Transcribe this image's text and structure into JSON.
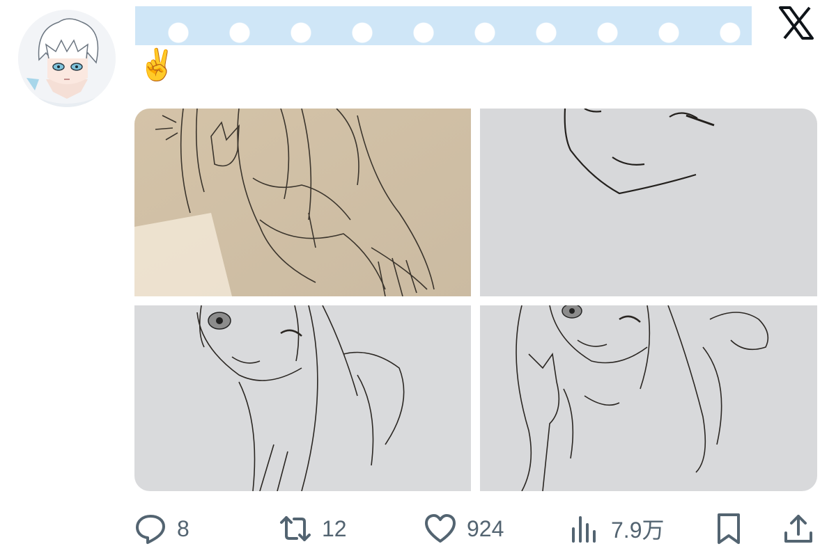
{
  "post": {
    "text": "✌️",
    "author_avatar_icon": "anime-avatar-icon",
    "platform_icon": "x-logo-icon"
  },
  "media": [
    {
      "icon": "sketch-girl-peace-sign-image"
    },
    {
      "icon": "sketch-face-closeup-image"
    },
    {
      "icon": "sketch-girl-wink-image"
    },
    {
      "icon": "sketch-girl-wink-peace-image"
    }
  ],
  "actions": {
    "reply": {
      "count": "8",
      "icon": "reply-icon"
    },
    "retweet": {
      "count": "12",
      "icon": "retweet-icon"
    },
    "like": {
      "count": "924",
      "icon": "heart-icon"
    },
    "views": {
      "count": "7.9万",
      "icon": "views-icon"
    },
    "bookmark": {
      "icon": "bookmark-icon"
    },
    "share": {
      "icon": "share-icon"
    }
  },
  "colors": {
    "icon_gray": "#536471",
    "text_dark": "#0f1419",
    "redaction_blue": "#cfe6f7"
  }
}
